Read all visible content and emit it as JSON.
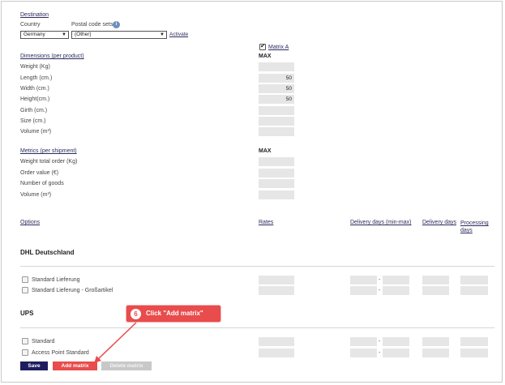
{
  "destination": {
    "heading": "Destination",
    "country_label": "Country",
    "postal_label": "Postal code sets",
    "country_value": "Germany",
    "postal_value": "(Other)",
    "activate_link": "Activate",
    "info_glyph": "i"
  },
  "matrix": {
    "label": "Matrix A",
    "checked": true
  },
  "dimensions": {
    "heading": "Dimensions (per product)",
    "max_label": "MAX",
    "rows": [
      {
        "label": "Weight (Kg)",
        "value": ""
      },
      {
        "label": "Length (cm.)",
        "value": "50"
      },
      {
        "label": "Width (cm.)",
        "value": "50"
      },
      {
        "label": "Height(cm.)",
        "value": "50"
      },
      {
        "label": "Girth (cm.)",
        "value": ""
      },
      {
        "label": "Size (cm.)",
        "value": ""
      },
      {
        "label": "Volume (m³)",
        "value": ""
      }
    ]
  },
  "metrics": {
    "heading": "Metrics (per shipment)",
    "max_label": "MAX",
    "rows": [
      {
        "label": "Weight total order (Kg)",
        "value": ""
      },
      {
        "label": "Order value (€)",
        "value": ""
      },
      {
        "label": "Number of goods",
        "value": ""
      },
      {
        "label": "Volume (m³)",
        "value": ""
      }
    ]
  },
  "options_header": {
    "options": "Options",
    "rates": "Rates",
    "delivery_minmax": "Delivery days (min-max)",
    "delivery_days": "Delivery days",
    "processing_days": "Processing days"
  },
  "carriers": [
    {
      "name": "DHL Deutschland",
      "services": [
        "Standard Lieferung",
        "Standard Lieferung - Großartikel"
      ]
    },
    {
      "name": "UPS",
      "services": [
        "Standard",
        "Access Point Standard"
      ]
    }
  ],
  "range_dash": "-",
  "buttons": {
    "save": "Save",
    "add_matrix": "Add matrix",
    "delete_matrix": "Delete matrix"
  },
  "callout": {
    "number": "6",
    "text": "Click \"Add matrix\""
  },
  "colors": {
    "save_bg": "#1d1d5e",
    "add_bg": "#e84c4c",
    "delete_bg": "#c8c8c8",
    "field_bg": "#e6e6e6",
    "callout_bg": "#e84c4c"
  }
}
